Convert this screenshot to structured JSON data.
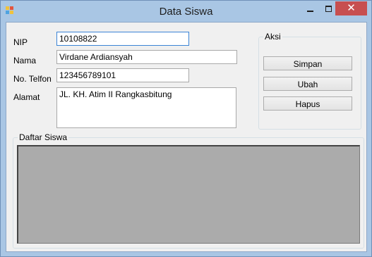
{
  "window": {
    "title": "Data Siswa",
    "close_glyph": "✕"
  },
  "form": {
    "nip_label": "NIP",
    "nip_value": "10108822",
    "nama_label": "Nama",
    "nama_value": "Virdane Ardiansyah",
    "telfon_label": "No. Telfon",
    "telfon_value": "123456789101",
    "alamat_label": "Alamat",
    "alamat_value": "JL. KH. Atim II Rangkasbitung"
  },
  "aksi": {
    "title": "Aksi",
    "simpan_label": "Simpan",
    "ubah_label": "Ubah",
    "hapus_label": "Hapus"
  },
  "daftar": {
    "title": "Daftar Siswa"
  },
  "colors": {
    "window_frame": "#a9c6e4",
    "close_button": "#c74f50",
    "client_bg": "#f0f0f0",
    "grid_bg": "#ababab",
    "focus_border": "#3b84d6"
  }
}
